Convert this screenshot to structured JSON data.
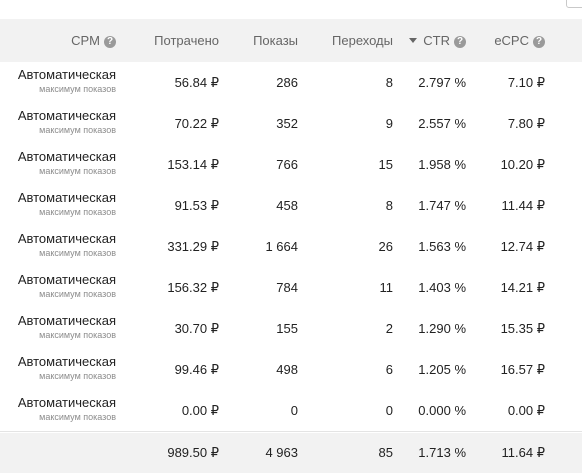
{
  "header": {
    "cpm": "CPM",
    "spent": "Потрачено",
    "shows": "Показы",
    "clicks": "Переходы",
    "ctr": "CTR",
    "ecpc": "eCPC",
    "help_glyph": "?"
  },
  "rows": [
    {
      "name": "Автоматическая",
      "sub": "максимум показов",
      "spent": "56.84 ₽",
      "shows": "286",
      "clicks": "8",
      "ctr": "2.797 %",
      "ecpc": "7.10 ₽"
    },
    {
      "name": "Автоматическая",
      "sub": "максимум показов",
      "spent": "70.22 ₽",
      "shows": "352",
      "clicks": "9",
      "ctr": "2.557 %",
      "ecpc": "7.80 ₽"
    },
    {
      "name": "Автоматическая",
      "sub": "максимум показов",
      "spent": "153.14 ₽",
      "shows": "766",
      "clicks": "15",
      "ctr": "1.958 %",
      "ecpc": "10.20 ₽"
    },
    {
      "name": "Автоматическая",
      "sub": "максимум показов",
      "spent": "91.53 ₽",
      "shows": "458",
      "clicks": "8",
      "ctr": "1.747 %",
      "ecpc": "11.44 ₽"
    },
    {
      "name": "Автоматическая",
      "sub": "максимум показов",
      "spent": "331.29 ₽",
      "shows": "1 664",
      "clicks": "26",
      "ctr": "1.563 %",
      "ecpc": "12.74 ₽"
    },
    {
      "name": "Автоматическая",
      "sub": "максимум показов",
      "spent": "156.32 ₽",
      "shows": "784",
      "clicks": "11",
      "ctr": "1.403 %",
      "ecpc": "14.21 ₽"
    },
    {
      "name": "Автоматическая",
      "sub": "максимум показов",
      "spent": "30.70 ₽",
      "shows": "155",
      "clicks": "2",
      "ctr": "1.290 %",
      "ecpc": "15.35 ₽"
    },
    {
      "name": "Автоматическая",
      "sub": "максимум показов",
      "spent": "99.46 ₽",
      "shows": "498",
      "clicks": "6",
      "ctr": "1.205 %",
      "ecpc": "16.57 ₽"
    },
    {
      "name": "Автоматическая",
      "sub": "максимум показов",
      "spent": "0.00 ₽",
      "shows": "0",
      "clicks": "0",
      "ctr": "0.000 %",
      "ecpc": "0.00 ₽"
    }
  ],
  "totals": {
    "spent": "989.50 ₽",
    "shows": "4 963",
    "clicks": "85",
    "ctr": "1.713 %",
    "ecpc": "11.64 ₽"
  },
  "sort": {
    "column": "ctr",
    "direction": "desc"
  },
  "icons": {
    "help": "help-circle-icon",
    "sort": "sort-desc-arrow-icon"
  },
  "colors": {
    "header_bg": "#f2f2f2",
    "help_icon": "#9a9a9a",
    "row_border": "#e4e4e4",
    "subtext": "#8c8c8c"
  }
}
